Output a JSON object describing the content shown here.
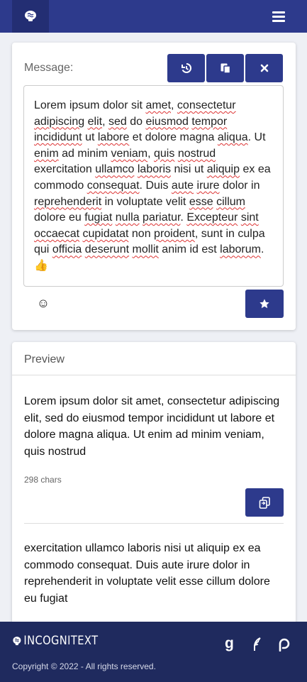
{
  "navbar": {
    "logo_icon": "brain-logo-icon",
    "menu_icon": "hamburger-icon"
  },
  "message": {
    "label": "Message:",
    "buttons": [
      "history-icon",
      "paste-icon",
      "close-icon"
    ],
    "text": "Lorem ipsum dolor sit amet, consectetur adipiscing elit, sed do eiusmod tempor incididunt ut labore et dolore magna aliqua. Ut enim ad minim veniam, quis nostrud exercitation ullamco laboris nisi ut aliquip ex ea commodo consequat. Duis aute irure dolor in reprehenderit in voluptate velit esse cillum dolore eu fugiat nulla pariatur. Excepteur sint occaecat cupidatat non proident, sunt in culpa qui officia deserunt mollit anim id est laborum.",
    "emoji_suffix": "👍",
    "emoji_button": "☺",
    "star_icon": "star-icon"
  },
  "preview": {
    "title": "Preview",
    "chunks": [
      {
        "text": "Lorem ipsum dolor sit amet, consectetur adipiscing elit, sed do eiusmod tempor incididunt ut labore et dolore magna aliqua. Ut enim ad minim veniam, quis nostrud",
        "chars": "298 chars"
      },
      {
        "text": "exercitation ullamco laboris nisi ut aliquip ex ea commodo consequat. Duis aute irure dolor in reprehenderit in voluptate velit esse cillum dolore eu fugiat"
      }
    ]
  },
  "footer": {
    "brand": "INCOGNITEXT",
    "copyright": "Copyright © 2022 - All rights reserved.",
    "social": [
      "goodreads-icon",
      "feather-icon",
      "patreon-icon"
    ]
  },
  "colors": {
    "primary": "#2d3a8c",
    "footer": "#1f2a5e",
    "background": "#eef0f5"
  }
}
